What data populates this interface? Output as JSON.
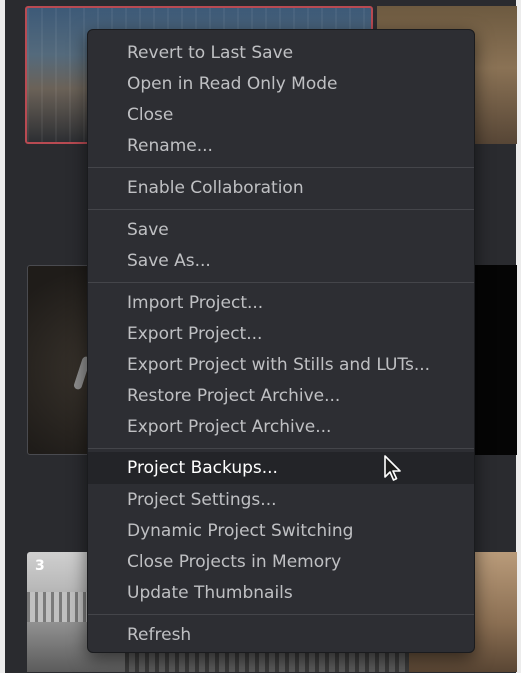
{
  "project_browser": {
    "thumbnail_3_number": "3"
  },
  "context_menu": {
    "sections": [
      {
        "items": [
          {
            "label": "Revert to Last Save"
          },
          {
            "label": "Open in Read Only Mode"
          },
          {
            "label": "Close"
          },
          {
            "label": "Rename..."
          }
        ]
      },
      {
        "items": [
          {
            "label": "Enable Collaboration"
          }
        ]
      },
      {
        "items": [
          {
            "label": "Save"
          },
          {
            "label": "Save As..."
          }
        ]
      },
      {
        "items": [
          {
            "label": "Import Project..."
          },
          {
            "label": "Export Project..."
          },
          {
            "label": "Export Project with Stills and LUTs..."
          },
          {
            "label": "Restore Project Archive..."
          },
          {
            "label": "Export Project Archive..."
          }
        ]
      },
      {
        "items": [
          {
            "label": "Project Backups...",
            "highlighted": true
          },
          {
            "label": "Project Settings..."
          },
          {
            "label": "Dynamic Project Switching"
          },
          {
            "label": "Close Projects in Memory"
          },
          {
            "label": "Update Thumbnails"
          }
        ]
      },
      {
        "items": [
          {
            "label": "Refresh"
          }
        ]
      }
    ]
  },
  "cursor": {
    "icon": "arrow-pointer-icon"
  },
  "colors": {
    "menu_background": "#2d2e33",
    "menu_text": "#bfc0c3",
    "highlight_background": "#232428",
    "highlight_text": "#ffffff",
    "selected_thumbnail_border": "#b84a52"
  }
}
